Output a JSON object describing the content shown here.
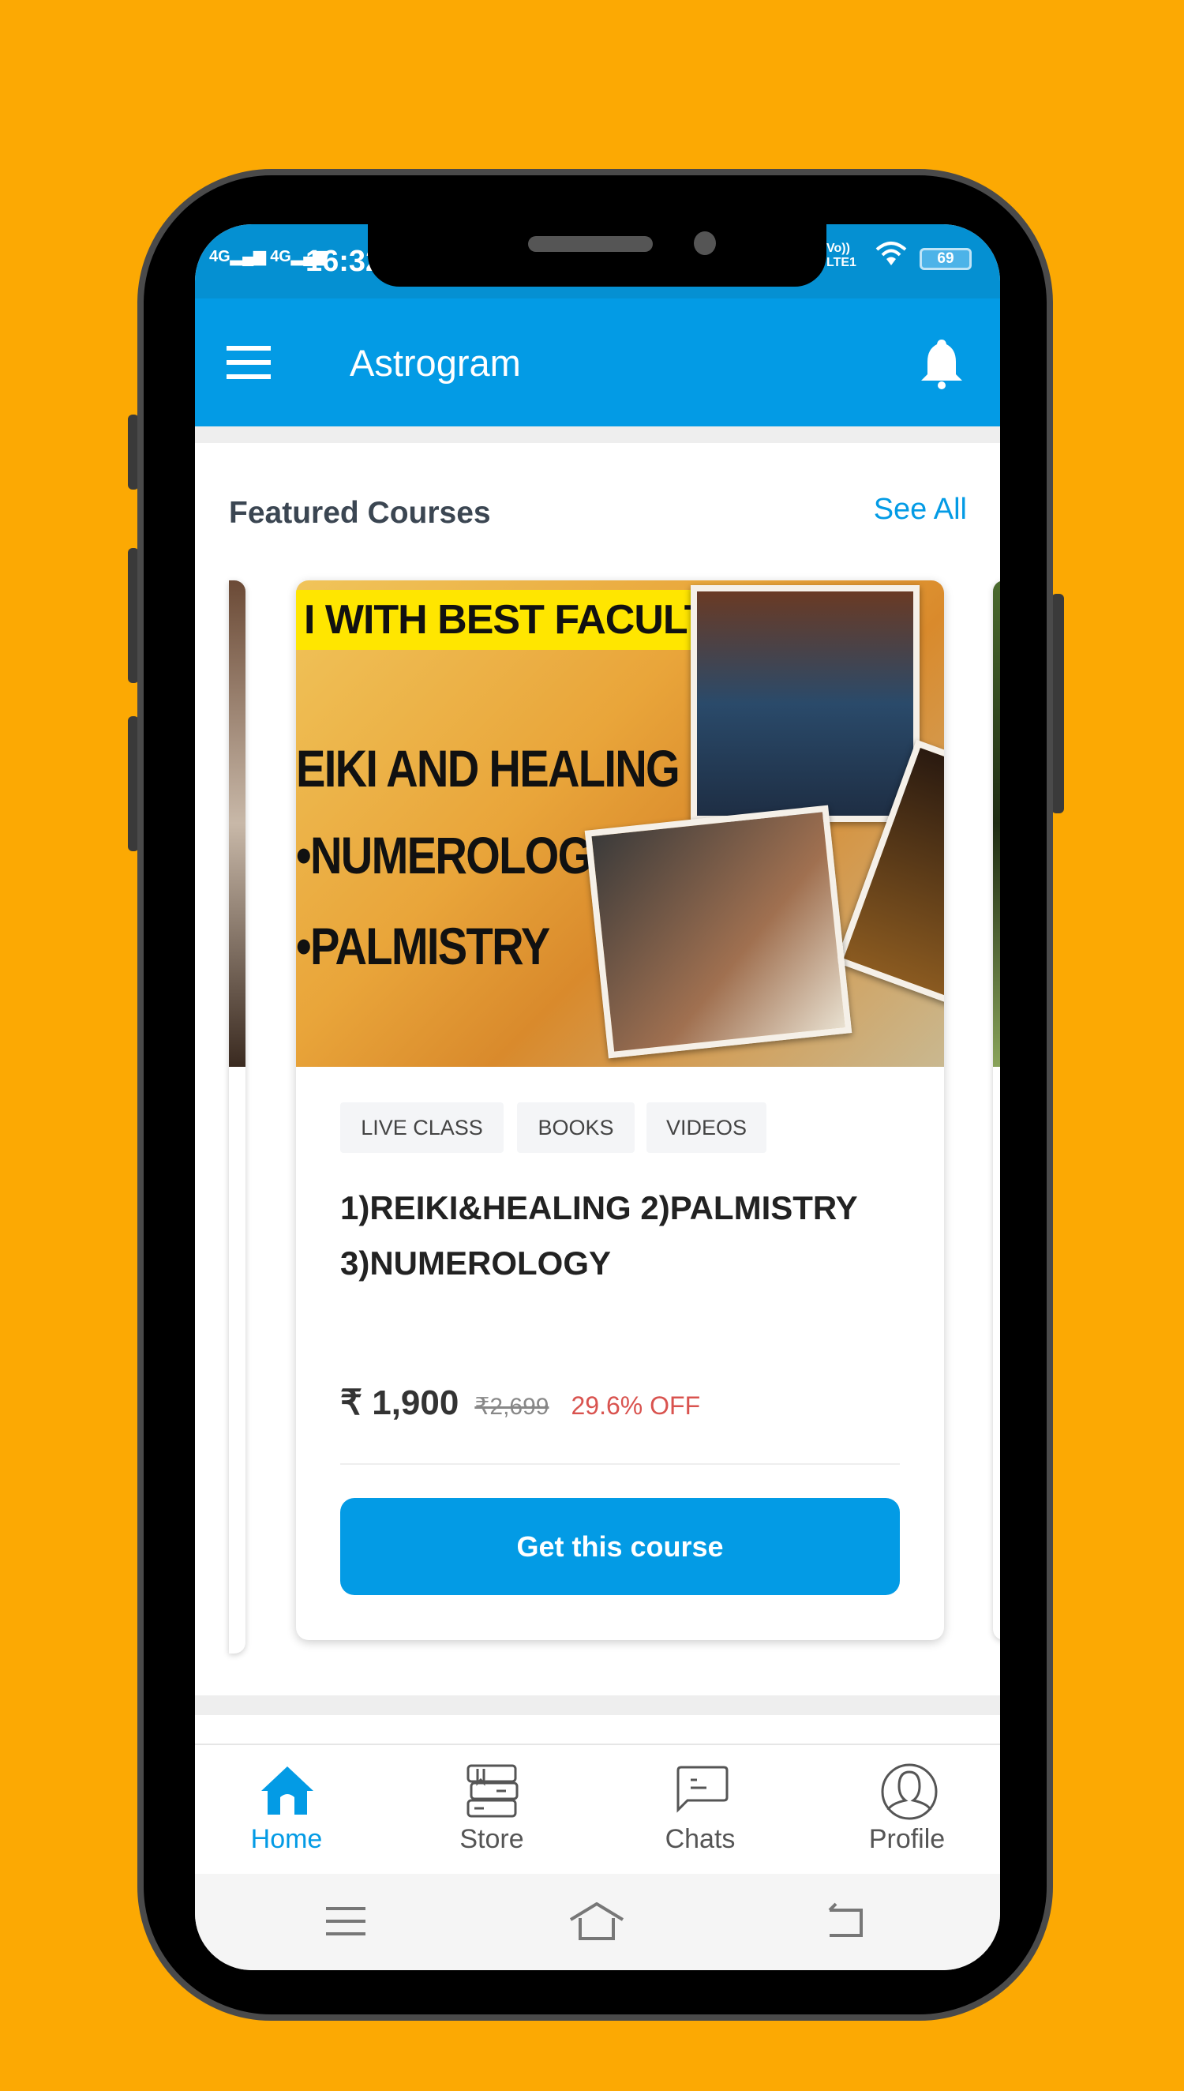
{
  "status_bar": {
    "signal1": "4G",
    "signal2": "4G",
    "time": "16:32",
    "network": "LTE1",
    "volte": "Vo))",
    "battery": "69"
  },
  "app_bar": {
    "title": "Astrogram",
    "menu_icon": "hamburger-icon",
    "notification_icon": "bell-icon"
  },
  "featured": {
    "title": "Featured Courses",
    "see_all": "See All",
    "course": {
      "image_text": {
        "banner": "I WITH BEST FACULTY",
        "line1": "EIKI AND HEALING",
        "line2": "•NUMEROLOGY",
        "line3": "•PALMISTRY"
      },
      "tags": [
        "LIVE CLASS",
        "BOOKS",
        "VIDEOS"
      ],
      "title": "1)REIKI&HEALING 2)PALMISTRY 3)NUMEROLOGY",
      "price": "₹ 1,900",
      "original_price": "₹2,699",
      "discount": "29.6% OFF",
      "button": "Get this course"
    }
  },
  "bottom_nav": {
    "items": [
      {
        "label": "Home",
        "icon": "home-icon",
        "active": true
      },
      {
        "label": "Store",
        "icon": "books-icon",
        "active": false
      },
      {
        "label": "Chats",
        "icon": "chat-icon",
        "active": false
      },
      {
        "label": "Profile",
        "icon": "profile-icon",
        "active": false
      }
    ]
  },
  "colors": {
    "background": "#FCA903",
    "primary": "#039BE5",
    "discount": "#d9534f"
  }
}
